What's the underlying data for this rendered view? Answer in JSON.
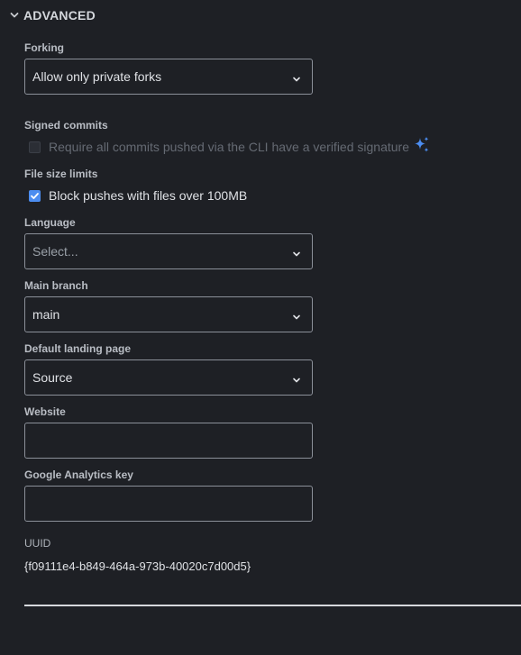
{
  "section": {
    "title": "ADVANCED",
    "icon": "chevron-down-icon"
  },
  "forking": {
    "label": "Forking",
    "value": "Allow only private forks"
  },
  "signed_commits": {
    "label": "Signed commits",
    "checkbox_label": "Require all commits pushed via the CLI have a verified signature",
    "checked": false,
    "disabled": true,
    "badge_icon": "sparkle-icon",
    "badge_color": "#4c8df0"
  },
  "file_size_limits": {
    "label": "File size limits",
    "checkbox_label": "Block pushes with files over 100MB",
    "checked": true
  },
  "language": {
    "label": "Language",
    "placeholder": "Select..."
  },
  "main_branch": {
    "label": "Main branch",
    "value": "main"
  },
  "landing_page": {
    "label": "Default landing page",
    "value": "Source"
  },
  "website": {
    "label": "Website",
    "value": ""
  },
  "analytics": {
    "label": "Google Analytics key",
    "value": ""
  },
  "uuid": {
    "label": "UUID",
    "value": "{f09111e4-b849-464a-973b-40020c7d00d5}"
  },
  "colors": {
    "background": "#1e2025",
    "accent": "#4c8df0",
    "border": "#8b9099"
  }
}
